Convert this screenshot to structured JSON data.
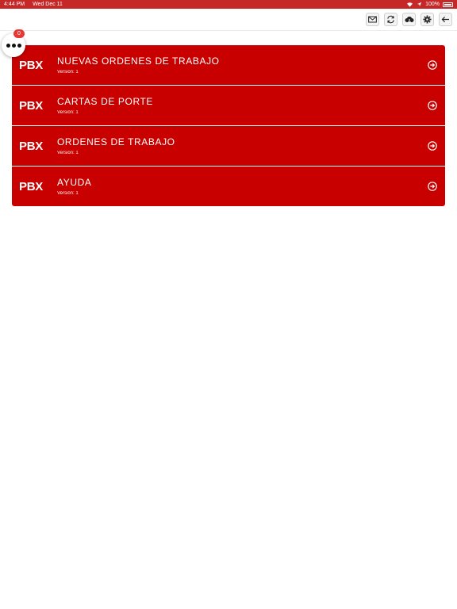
{
  "status": {
    "time": "4:44 PM",
    "date": "Wed Dec 11",
    "battery": "100%"
  },
  "notifications": {
    "count": "0"
  },
  "toolbar": {
    "icons": [
      "mail-icon",
      "sync-icon",
      "cloud-download-icon",
      "gear-icon",
      "back-arrow-icon"
    ]
  },
  "items": [
    {
      "logo": "PBX",
      "title": "NUEVAS ORDENES DE TRABAJO",
      "version": "Versión: 1"
    },
    {
      "logo": "PBX",
      "title": "CARTAS DE PORTE",
      "version": "Versión: 1"
    },
    {
      "logo": "PBX",
      "title": "ORDENES DE TRABAJO",
      "version": "Versión: 1"
    },
    {
      "logo": "PBX",
      "title": "AYUDA",
      "version": "Versión: 1"
    }
  ],
  "colors": {
    "status_bar": "#c62828",
    "item_bg": "#c80000",
    "badge": "#e53935"
  }
}
